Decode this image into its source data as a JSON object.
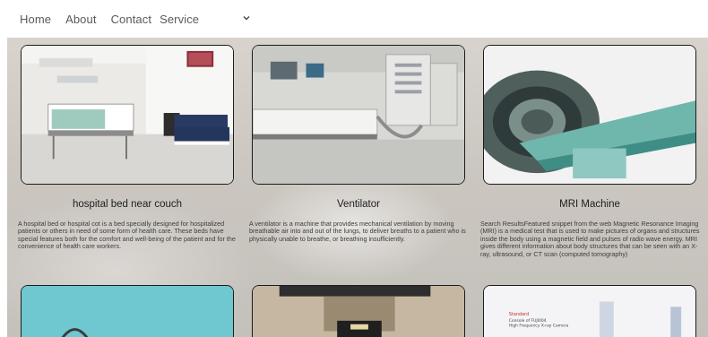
{
  "nav": {
    "items": [
      "Home",
      "About",
      "Contact"
    ],
    "service_label": "Service",
    "service_icon": "chevron-down-icon"
  },
  "cards": [
    {
      "title": "hospital bed near couch",
      "description": "A hospital bed or hospital cot is a bed specially designed for hospitalized patients or others in need of some form of health care. These beds have special features both for the comfort and well-being of the patient and for the convenience of health care workers."
    },
    {
      "title": "Ventilator",
      "description": "A ventilator is a machine that provides mechanical ventilation by moving breathable air into and out of the lungs, to deliver breaths to a patient who is physically unable to breathe, or breathing insufficiently."
    },
    {
      "title": "MRI Machine",
      "description": "Search ResultsFeatured snippet from the web Magnetic Resonance Imaging (MRI) is a medical test that is used to make pictures of organs and structures inside the body using a magnetic field and pulses of radio wave energy. MRI gives different information about body structures that can be seen with an X-ray, ultrasound, or CT scan (computed tomography)"
    }
  ],
  "row2_image_text": {
    "line1": "Standard",
    "line2": "Console of FUJI004",
    "line3": "High Frequency X-ray Camera"
  }
}
